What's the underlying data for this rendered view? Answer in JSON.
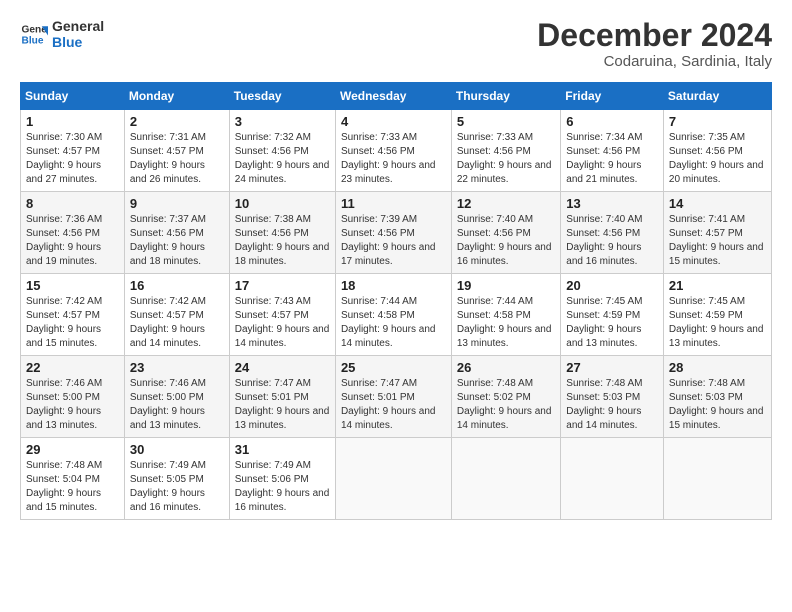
{
  "logo": {
    "line1": "General",
    "line2": "Blue"
  },
  "title": "December 2024",
  "subtitle": "Codaruina, Sardinia, Italy",
  "headers": [
    "Sunday",
    "Monday",
    "Tuesday",
    "Wednesday",
    "Thursday",
    "Friday",
    "Saturday"
  ],
  "weeks": [
    [
      {
        "day": "1",
        "sunrise": "7:30 AM",
        "sunset": "4:57 PM",
        "daylight": "9 hours and 27 minutes."
      },
      {
        "day": "2",
        "sunrise": "7:31 AM",
        "sunset": "4:57 PM",
        "daylight": "9 hours and 26 minutes."
      },
      {
        "day": "3",
        "sunrise": "7:32 AM",
        "sunset": "4:56 PM",
        "daylight": "9 hours and 24 minutes."
      },
      {
        "day": "4",
        "sunrise": "7:33 AM",
        "sunset": "4:56 PM",
        "daylight": "9 hours and 23 minutes."
      },
      {
        "day": "5",
        "sunrise": "7:33 AM",
        "sunset": "4:56 PM",
        "daylight": "9 hours and 22 minutes."
      },
      {
        "day": "6",
        "sunrise": "7:34 AM",
        "sunset": "4:56 PM",
        "daylight": "9 hours and 21 minutes."
      },
      {
        "day": "7",
        "sunrise": "7:35 AM",
        "sunset": "4:56 PM",
        "daylight": "9 hours and 20 minutes."
      }
    ],
    [
      {
        "day": "8",
        "sunrise": "7:36 AM",
        "sunset": "4:56 PM",
        "daylight": "9 hours and 19 minutes."
      },
      {
        "day": "9",
        "sunrise": "7:37 AM",
        "sunset": "4:56 PM",
        "daylight": "9 hours and 18 minutes."
      },
      {
        "day": "10",
        "sunrise": "7:38 AM",
        "sunset": "4:56 PM",
        "daylight": "9 hours and 18 minutes."
      },
      {
        "day": "11",
        "sunrise": "7:39 AM",
        "sunset": "4:56 PM",
        "daylight": "9 hours and 17 minutes."
      },
      {
        "day": "12",
        "sunrise": "7:40 AM",
        "sunset": "4:56 PM",
        "daylight": "9 hours and 16 minutes."
      },
      {
        "day": "13",
        "sunrise": "7:40 AM",
        "sunset": "4:56 PM",
        "daylight": "9 hours and 16 minutes."
      },
      {
        "day": "14",
        "sunrise": "7:41 AM",
        "sunset": "4:57 PM",
        "daylight": "9 hours and 15 minutes."
      }
    ],
    [
      {
        "day": "15",
        "sunrise": "7:42 AM",
        "sunset": "4:57 PM",
        "daylight": "9 hours and 15 minutes."
      },
      {
        "day": "16",
        "sunrise": "7:42 AM",
        "sunset": "4:57 PM",
        "daylight": "9 hours and 14 minutes."
      },
      {
        "day": "17",
        "sunrise": "7:43 AM",
        "sunset": "4:57 PM",
        "daylight": "9 hours and 14 minutes."
      },
      {
        "day": "18",
        "sunrise": "7:44 AM",
        "sunset": "4:58 PM",
        "daylight": "9 hours and 14 minutes."
      },
      {
        "day": "19",
        "sunrise": "7:44 AM",
        "sunset": "4:58 PM",
        "daylight": "9 hours and 13 minutes."
      },
      {
        "day": "20",
        "sunrise": "7:45 AM",
        "sunset": "4:59 PM",
        "daylight": "9 hours and 13 minutes."
      },
      {
        "day": "21",
        "sunrise": "7:45 AM",
        "sunset": "4:59 PM",
        "daylight": "9 hours and 13 minutes."
      }
    ],
    [
      {
        "day": "22",
        "sunrise": "7:46 AM",
        "sunset": "5:00 PM",
        "daylight": "9 hours and 13 minutes."
      },
      {
        "day": "23",
        "sunrise": "7:46 AM",
        "sunset": "5:00 PM",
        "daylight": "9 hours and 13 minutes."
      },
      {
        "day": "24",
        "sunrise": "7:47 AM",
        "sunset": "5:01 PM",
        "daylight": "9 hours and 13 minutes."
      },
      {
        "day": "25",
        "sunrise": "7:47 AM",
        "sunset": "5:01 PM",
        "daylight": "9 hours and 14 minutes."
      },
      {
        "day": "26",
        "sunrise": "7:48 AM",
        "sunset": "5:02 PM",
        "daylight": "9 hours and 14 minutes."
      },
      {
        "day": "27",
        "sunrise": "7:48 AM",
        "sunset": "5:03 PM",
        "daylight": "9 hours and 14 minutes."
      },
      {
        "day": "28",
        "sunrise": "7:48 AM",
        "sunset": "5:03 PM",
        "daylight": "9 hours and 15 minutes."
      }
    ],
    [
      {
        "day": "29",
        "sunrise": "7:48 AM",
        "sunset": "5:04 PM",
        "daylight": "9 hours and 15 minutes."
      },
      {
        "day": "30",
        "sunrise": "7:49 AM",
        "sunset": "5:05 PM",
        "daylight": "9 hours and 16 minutes."
      },
      {
        "day": "31",
        "sunrise": "7:49 AM",
        "sunset": "5:06 PM",
        "daylight": "9 hours and 16 minutes."
      },
      null,
      null,
      null,
      null
    ]
  ],
  "labels": {
    "sunrise": "Sunrise:",
    "sunset": "Sunset:",
    "daylight": "Daylight:"
  }
}
